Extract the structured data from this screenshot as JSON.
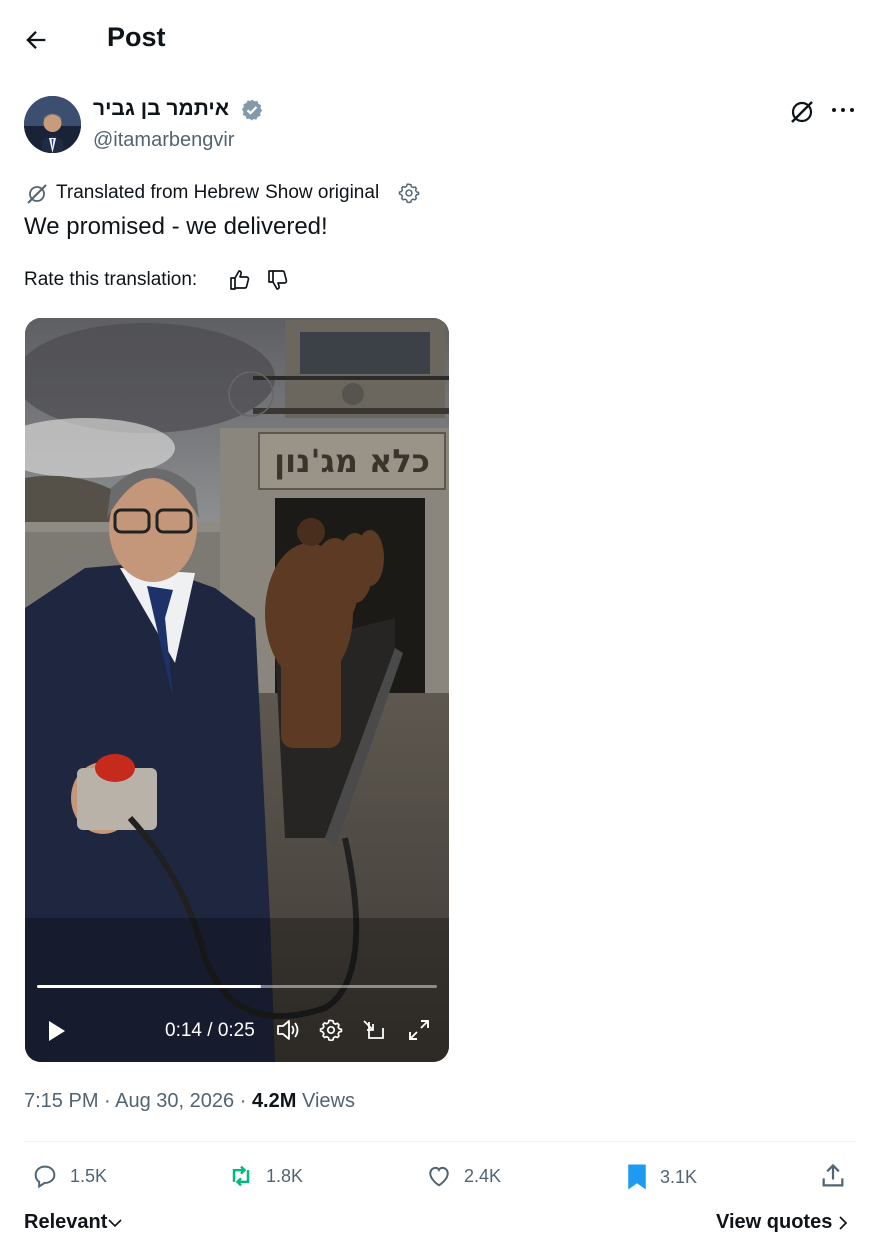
{
  "header": {
    "title": "Post",
    "back_icon": "arrow-left-icon"
  },
  "author": {
    "name": "איתמר בן גביר",
    "handle": "@itamarbengvir",
    "verified": true,
    "badge_color": "#829aab"
  },
  "translation": {
    "label": "Translated from Hebrew",
    "show_original": "Show original",
    "rate_label": "Rate this translation:"
  },
  "post": {
    "text": "We promised - we delivered!"
  },
  "media": {
    "sign_text": "כלא מג'נון",
    "time": "0:14 / 0:25",
    "progress": 0.56
  },
  "meta": {
    "time": "7:15 PM",
    "date": "Aug 30, 2026",
    "views_count": "4.2M",
    "views_label": "Views"
  },
  "actions": {
    "replies": "1.5K",
    "reposts": "1.8K",
    "likes": "2.4K",
    "bookmarks": "3.1K",
    "repost_color": "#00ba7c",
    "bookmark_color": "#1d9bf0"
  },
  "footer": {
    "sort_label": "Relevant",
    "quotes_label": "View quotes"
  }
}
